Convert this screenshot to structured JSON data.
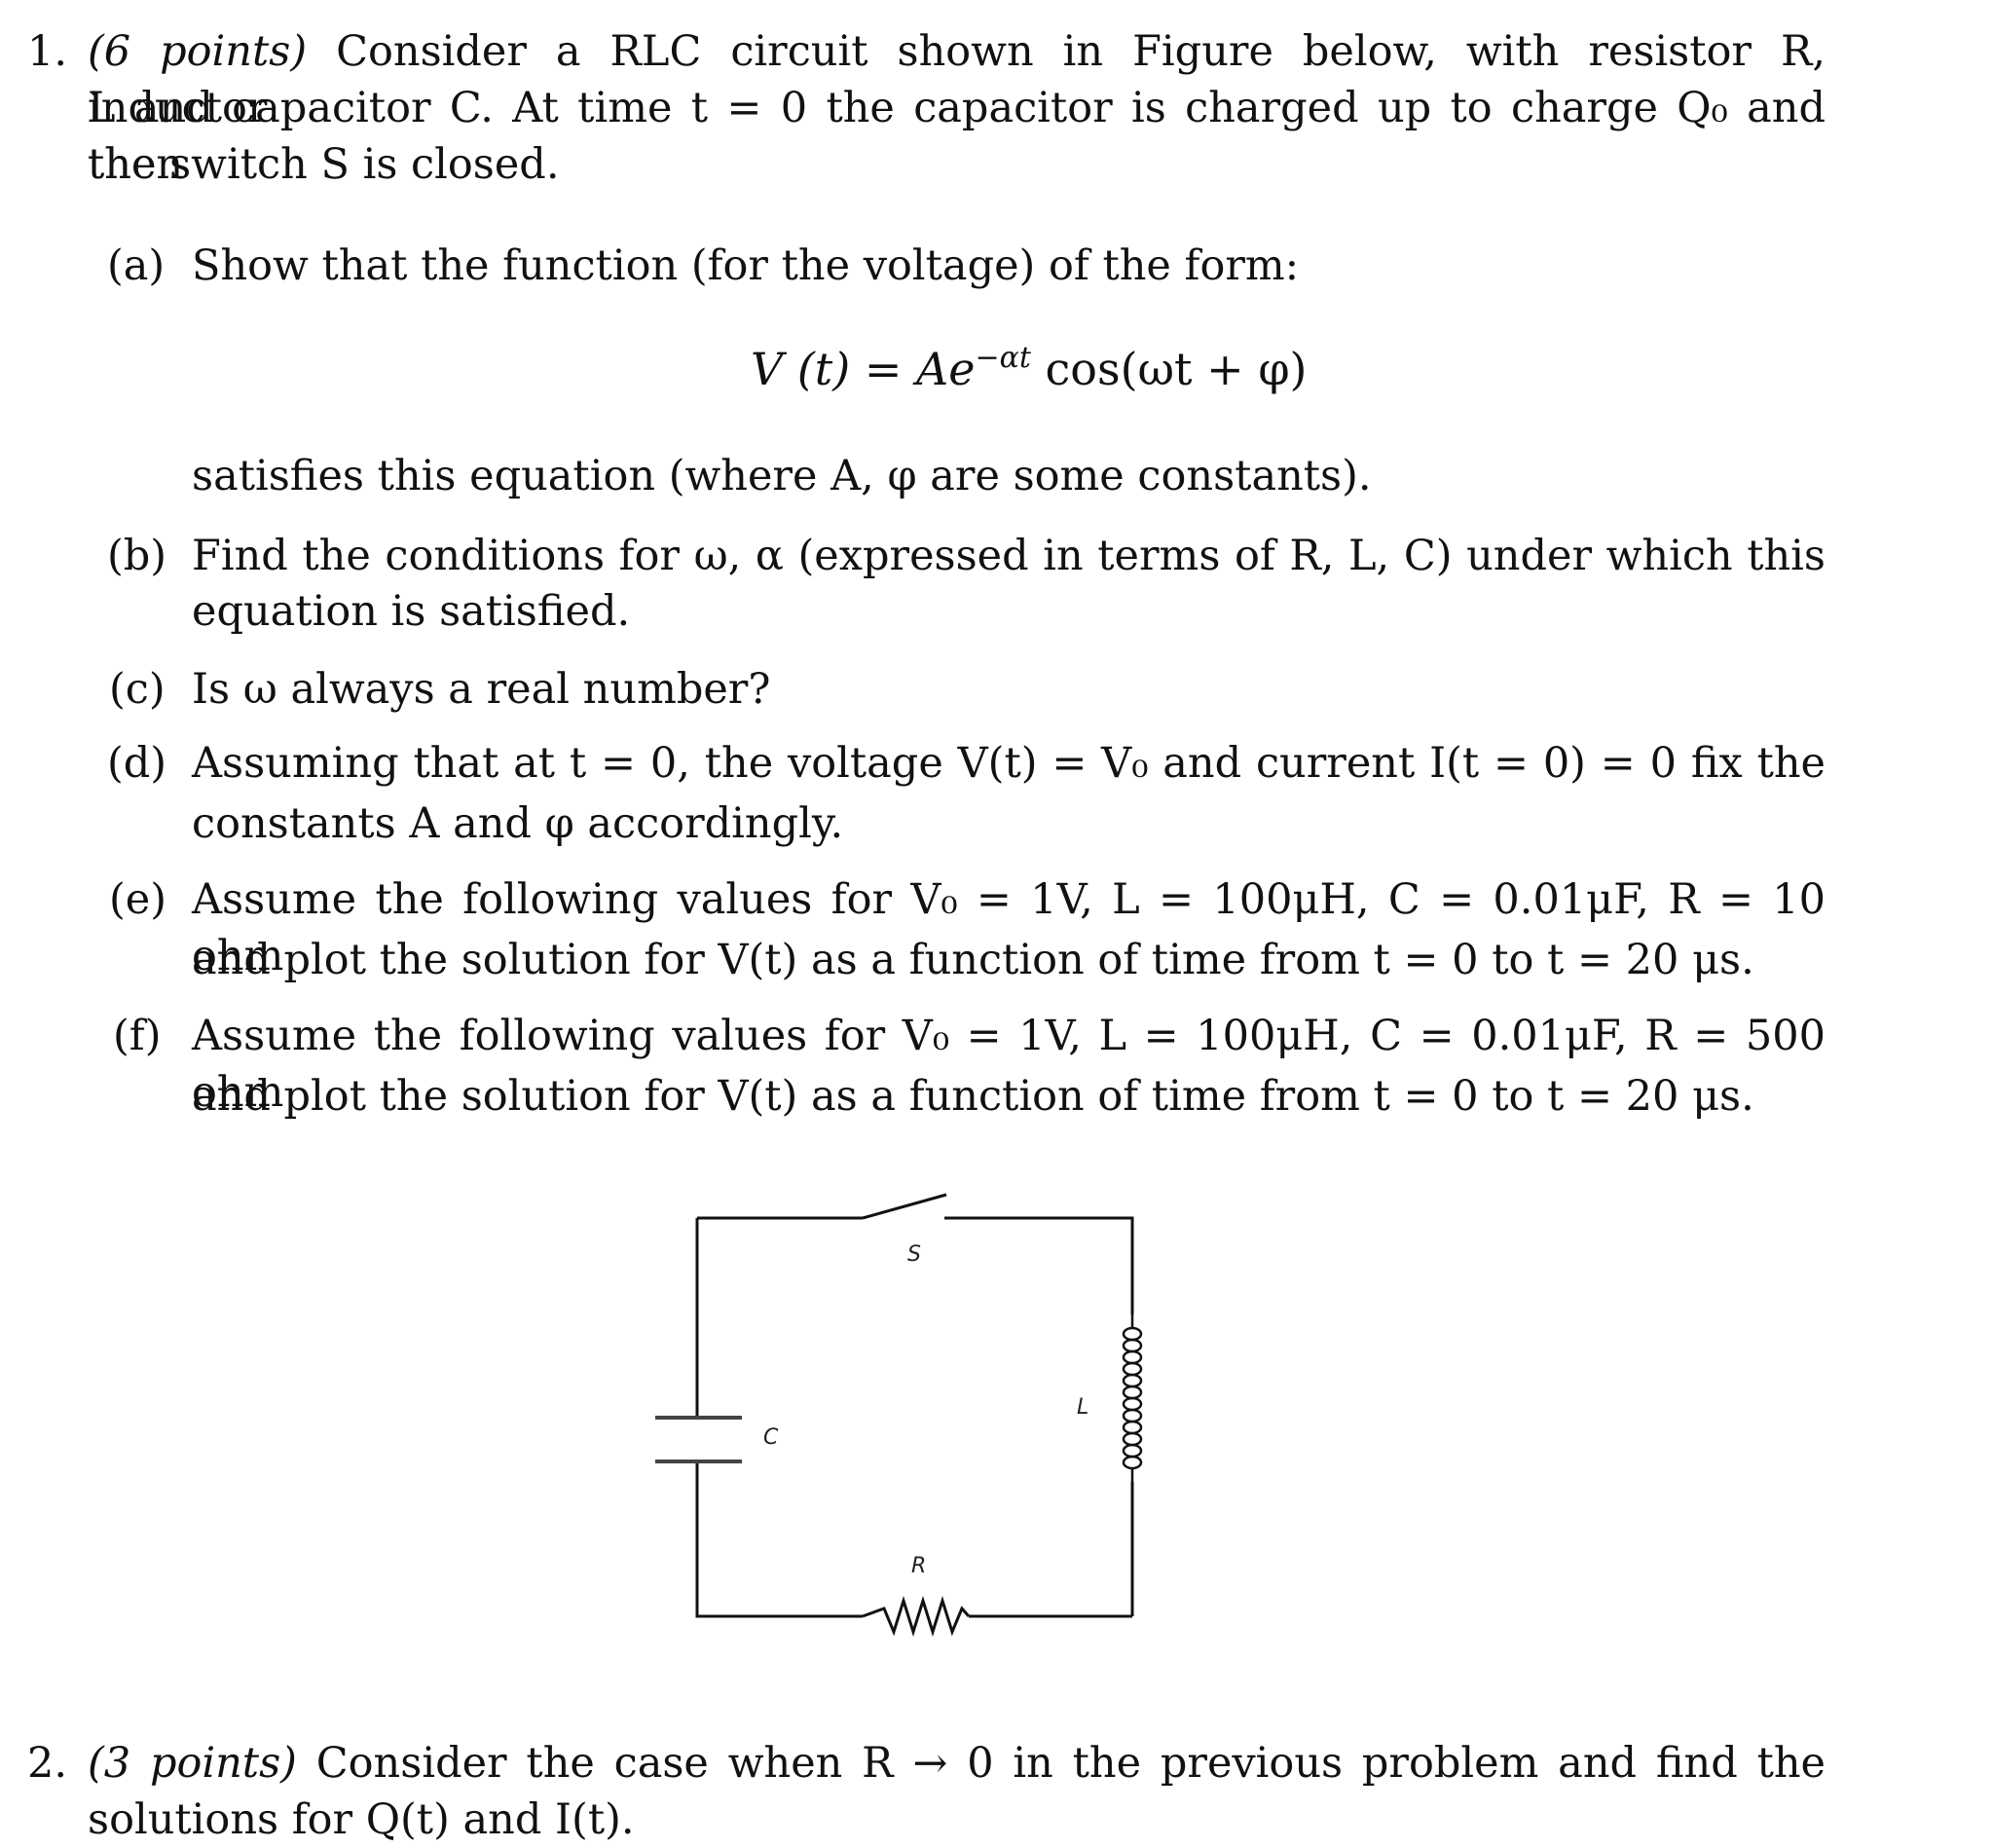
{
  "problem1": {
    "number": "1.",
    "points": "(6 points)",
    "intro_lines": [
      "Consider a RLC circuit shown in Figure below, with resistor R, inductor",
      "L and capacitor C. At time t = 0 the capacitor is charged up to charge Q₀ and then",
      "the switch S is closed."
    ],
    "parts": [
      {
        "label": "(a)",
        "lines": [
          "Show that the function (for the voltage) of the form:"
        ]
      },
      {
        "label": "",
        "lines": [
          "satisfies this equation (where A, φ are some constants)."
        ]
      },
      {
        "label": "(b)",
        "lines": [
          "Find the conditions for ω, α (expressed in terms of R, L, C) under which this",
          "equation is satisfied."
        ]
      },
      {
        "label": "(c)",
        "lines": [
          "Is ω always a real number?"
        ]
      },
      {
        "label": "(d)",
        "lines": [
          "Assuming that at t = 0, the voltage V(t) = V₀ and current I(t = 0) = 0 fix the",
          "constants A and φ accordingly."
        ]
      },
      {
        "label": "(e)",
        "lines": [
          "Assume the following values for V₀ = 1V, L = 100μH, C = 0.01μF, R = 10 ohm",
          "and plot the solution for V(t) as a function of time from t = 0 to t = 20 μs."
        ]
      },
      {
        "label": "(f)",
        "lines": [
          "Assume the following values for V₀ = 1V, L = 100μH, C = 0.01μF, R = 500 ohm",
          "and plot the solution for V(t) as a function of time from t = 0 to t = 20 μs."
        ]
      }
    ],
    "equation": {
      "lhs": "V (t) = Ae",
      "exponent": "−αt",
      "rhs": " cos(ωt + φ)"
    }
  },
  "circuit": {
    "labels": {
      "switch": "S",
      "capacitor": "C",
      "inductor": "L",
      "resistor": "R"
    }
  },
  "problem2": {
    "number": "2.",
    "points": "(3 points)",
    "lines": [
      "Consider the case when R → 0 in the previous problem and find the",
      "solutions for Q(t) and I(t)."
    ]
  }
}
